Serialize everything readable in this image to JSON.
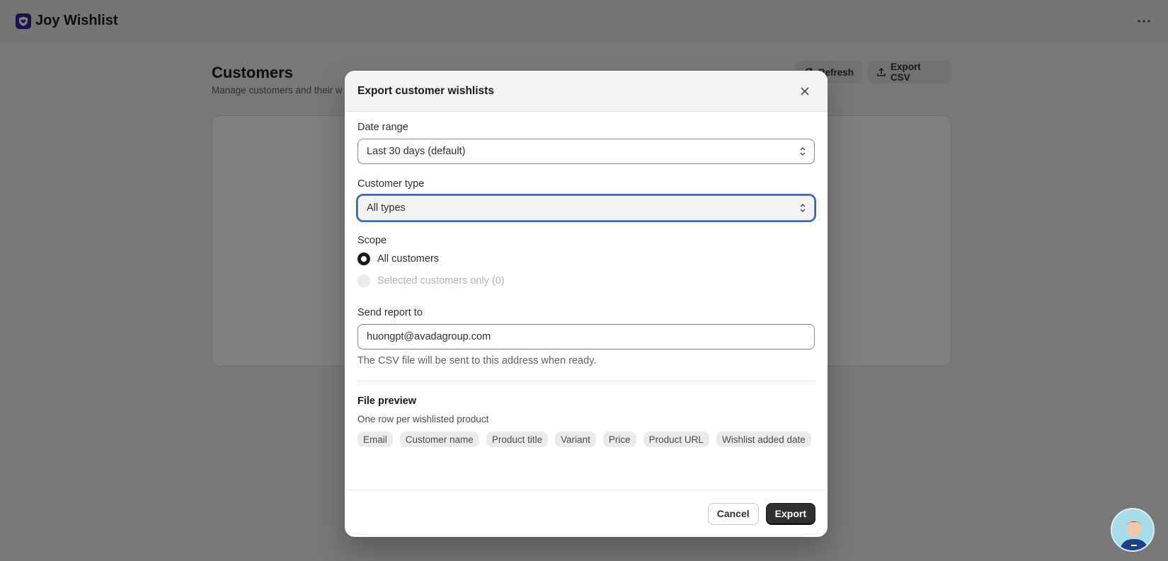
{
  "app": {
    "title": "Joy Wishlist",
    "logo_icon": "heart-shield-icon",
    "more_icon": "more-horizontal-icon"
  },
  "page": {
    "title": "Customers",
    "subtitle": "Manage customers and their w",
    "refresh_label": "Refresh",
    "export_csv_label": "Export CSV"
  },
  "modal": {
    "title": "Export customer wishlists",
    "date_range": {
      "label": "Date range",
      "value": "Last 30 days (default)"
    },
    "customer_type": {
      "label": "Customer type",
      "value": "All types"
    },
    "scope": {
      "label": "Scope",
      "options": [
        {
          "label": "All customers",
          "checked": true,
          "disabled": false
        },
        {
          "label": "Selected customers only (0)",
          "checked": false,
          "disabled": true
        }
      ]
    },
    "send_report": {
      "label": "Send report to",
      "value": "huongpt@avadagroup.com",
      "help": "The CSV file will be sent to this address when ready."
    },
    "file_preview": {
      "title": "File preview",
      "description": "One row per wishlisted product",
      "columns": [
        "Email",
        "Customer name",
        "Product title",
        "Variant",
        "Price",
        "Product URL",
        "Wishlist added date"
      ]
    },
    "cancel_label": "Cancel",
    "export_label": "Export"
  },
  "colors": {
    "focus_ring": "#2e63c8",
    "primary_button": "#303030",
    "logo": "#2c2a8c"
  }
}
